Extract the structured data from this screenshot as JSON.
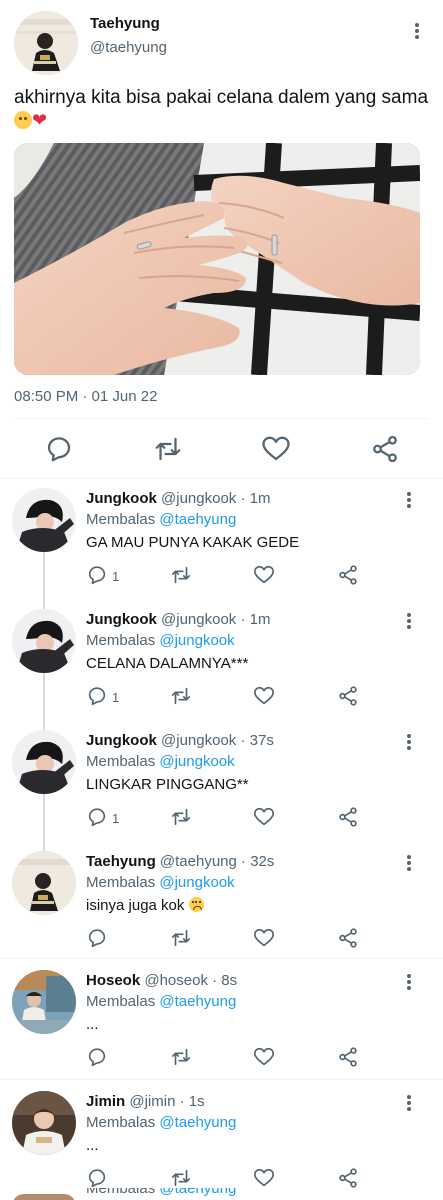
{
  "main_tweet": {
    "name": "Taehyung",
    "handle": "@taehyung",
    "text": "akhirnya kita bisa pakai celana dalem yang sama",
    "timestamp": "08:50 PM · 01 Jun 22",
    "photo_icon": "photo-hands-rings"
  },
  "replies": [
    {
      "name": "Jungkook",
      "handle": "@jungkook",
      "time": "· 1m",
      "replying_label": "Membalas",
      "replying_to": "@taehyung",
      "text": "GA MAU PUNYA KAKAK GEDE",
      "reply_count": "1"
    },
    {
      "name": "Jungkook",
      "handle": "@jungkook",
      "time": "· 1m",
      "replying_label": "Membalas",
      "replying_to": "@jungkook",
      "text": "CELANA DALAMNYA***",
      "reply_count": "1"
    },
    {
      "name": "Jungkook",
      "handle": "@jungkook",
      "time": "· 37s",
      "replying_label": "Membalas",
      "replying_to": "@jungkook",
      "text": "LINGKAR PINGGANG**",
      "reply_count": "1"
    },
    {
      "name": "Taehyung",
      "handle": "@taehyung",
      "time": "· 32s",
      "replying_label": "Membalas",
      "replying_to": "@jungkook",
      "text": "isinya juga kok",
      "reply_count": ""
    },
    {
      "name": "Hoseok",
      "handle": "@hoseok",
      "time": "· 8s",
      "replying_label": "Membalas",
      "replying_to": "@taehyung",
      "text": "...",
      "reply_count": ""
    },
    {
      "name": "Jimin",
      "handle": "@jimin",
      "time": "· 1s",
      "replying_label": "Membalas",
      "replying_to": "@taehyung",
      "text": "...",
      "reply_count": ""
    }
  ],
  "partial_row": {
    "replying_label": "Membalas",
    "replying_to": "@taehyung"
  },
  "colors": {
    "accent": "#1d9bf0",
    "muted": "#536471",
    "text": "#0f1419",
    "divider": "#eff3f4"
  }
}
